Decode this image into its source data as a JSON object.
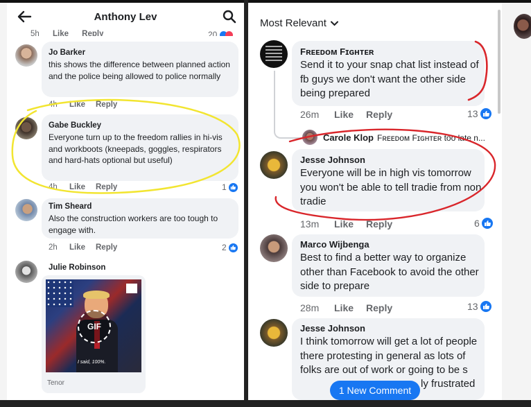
{
  "left": {
    "header_title": "Anthony Lev",
    "top_partial": {
      "time": "5h",
      "like": "Like",
      "reply": "Reply",
      "count": "20"
    },
    "comments": [
      {
        "name": "Jo Barker",
        "text": "this shows the difference between planned action and the police being allowed to police normally",
        "time": "4h",
        "like": "Like",
        "reply": "Reply"
      },
      {
        "name": "Gabe Buckley",
        "text": "Everyone turn up to the freedom rallies in hi-vis and workboots (kneepads, goggles, respirators and hard-hats optional but useful)",
        "time": "4h",
        "like": "Like",
        "reply": "Reply",
        "reactions": "1"
      },
      {
        "name": "Tim Sheard",
        "text": "Also the construction workers are too tough to engage with.",
        "time": "2h",
        "like": "Like",
        "reply": "Reply",
        "reactions": "2"
      },
      {
        "name": "Julie Robinson",
        "gif_label": "GIF",
        "gif_caption": "I said, 100%.",
        "gif_source": "Tenor"
      }
    ]
  },
  "right": {
    "sort_label": "Most Relevant",
    "comments": [
      {
        "name": "Fʀᴇᴇᴅᴏᴍ Fɪɢʜᴛᴇʀ",
        "text": "Send it to your snap chat list instead of fb guys we don't want the other side being prepared",
        "time": "26m",
        "like": "Like",
        "reply": "Reply",
        "reactions": "13"
      },
      {
        "reply_name": "Carole Klop",
        "reply_snippet": "Fʀᴇᴇᴅᴏᴍ Fɪɢʜᴛᴇʀ too late n..."
      },
      {
        "name": "Jesse Johnson",
        "text": "Everyone will be in high vis tomorrow you won't be able to tell tradie from non tradie",
        "time": "13m",
        "like": "Like",
        "reply": "Reply",
        "reactions": "6"
      },
      {
        "name": "Marco Wijbenga",
        "text": "Best to find a better way to organize other than Facebook to avoid the other side to prepare",
        "time": "28m",
        "like": "Like",
        "reply": "Reply",
        "reactions": "13"
      },
      {
        "name": "Jesse Johnson",
        "text": "I think tomorrow will get a lot of people there protesting in general as lots of folks are out of work or going to be s",
        "text_tail": "ly frustrated"
      }
    ],
    "new_comment_pill": "1 New Comment"
  },
  "colors": {
    "accent": "#1877f2",
    "yellow_circle": "#f2e531",
    "red_annotation": "#d9262b"
  }
}
